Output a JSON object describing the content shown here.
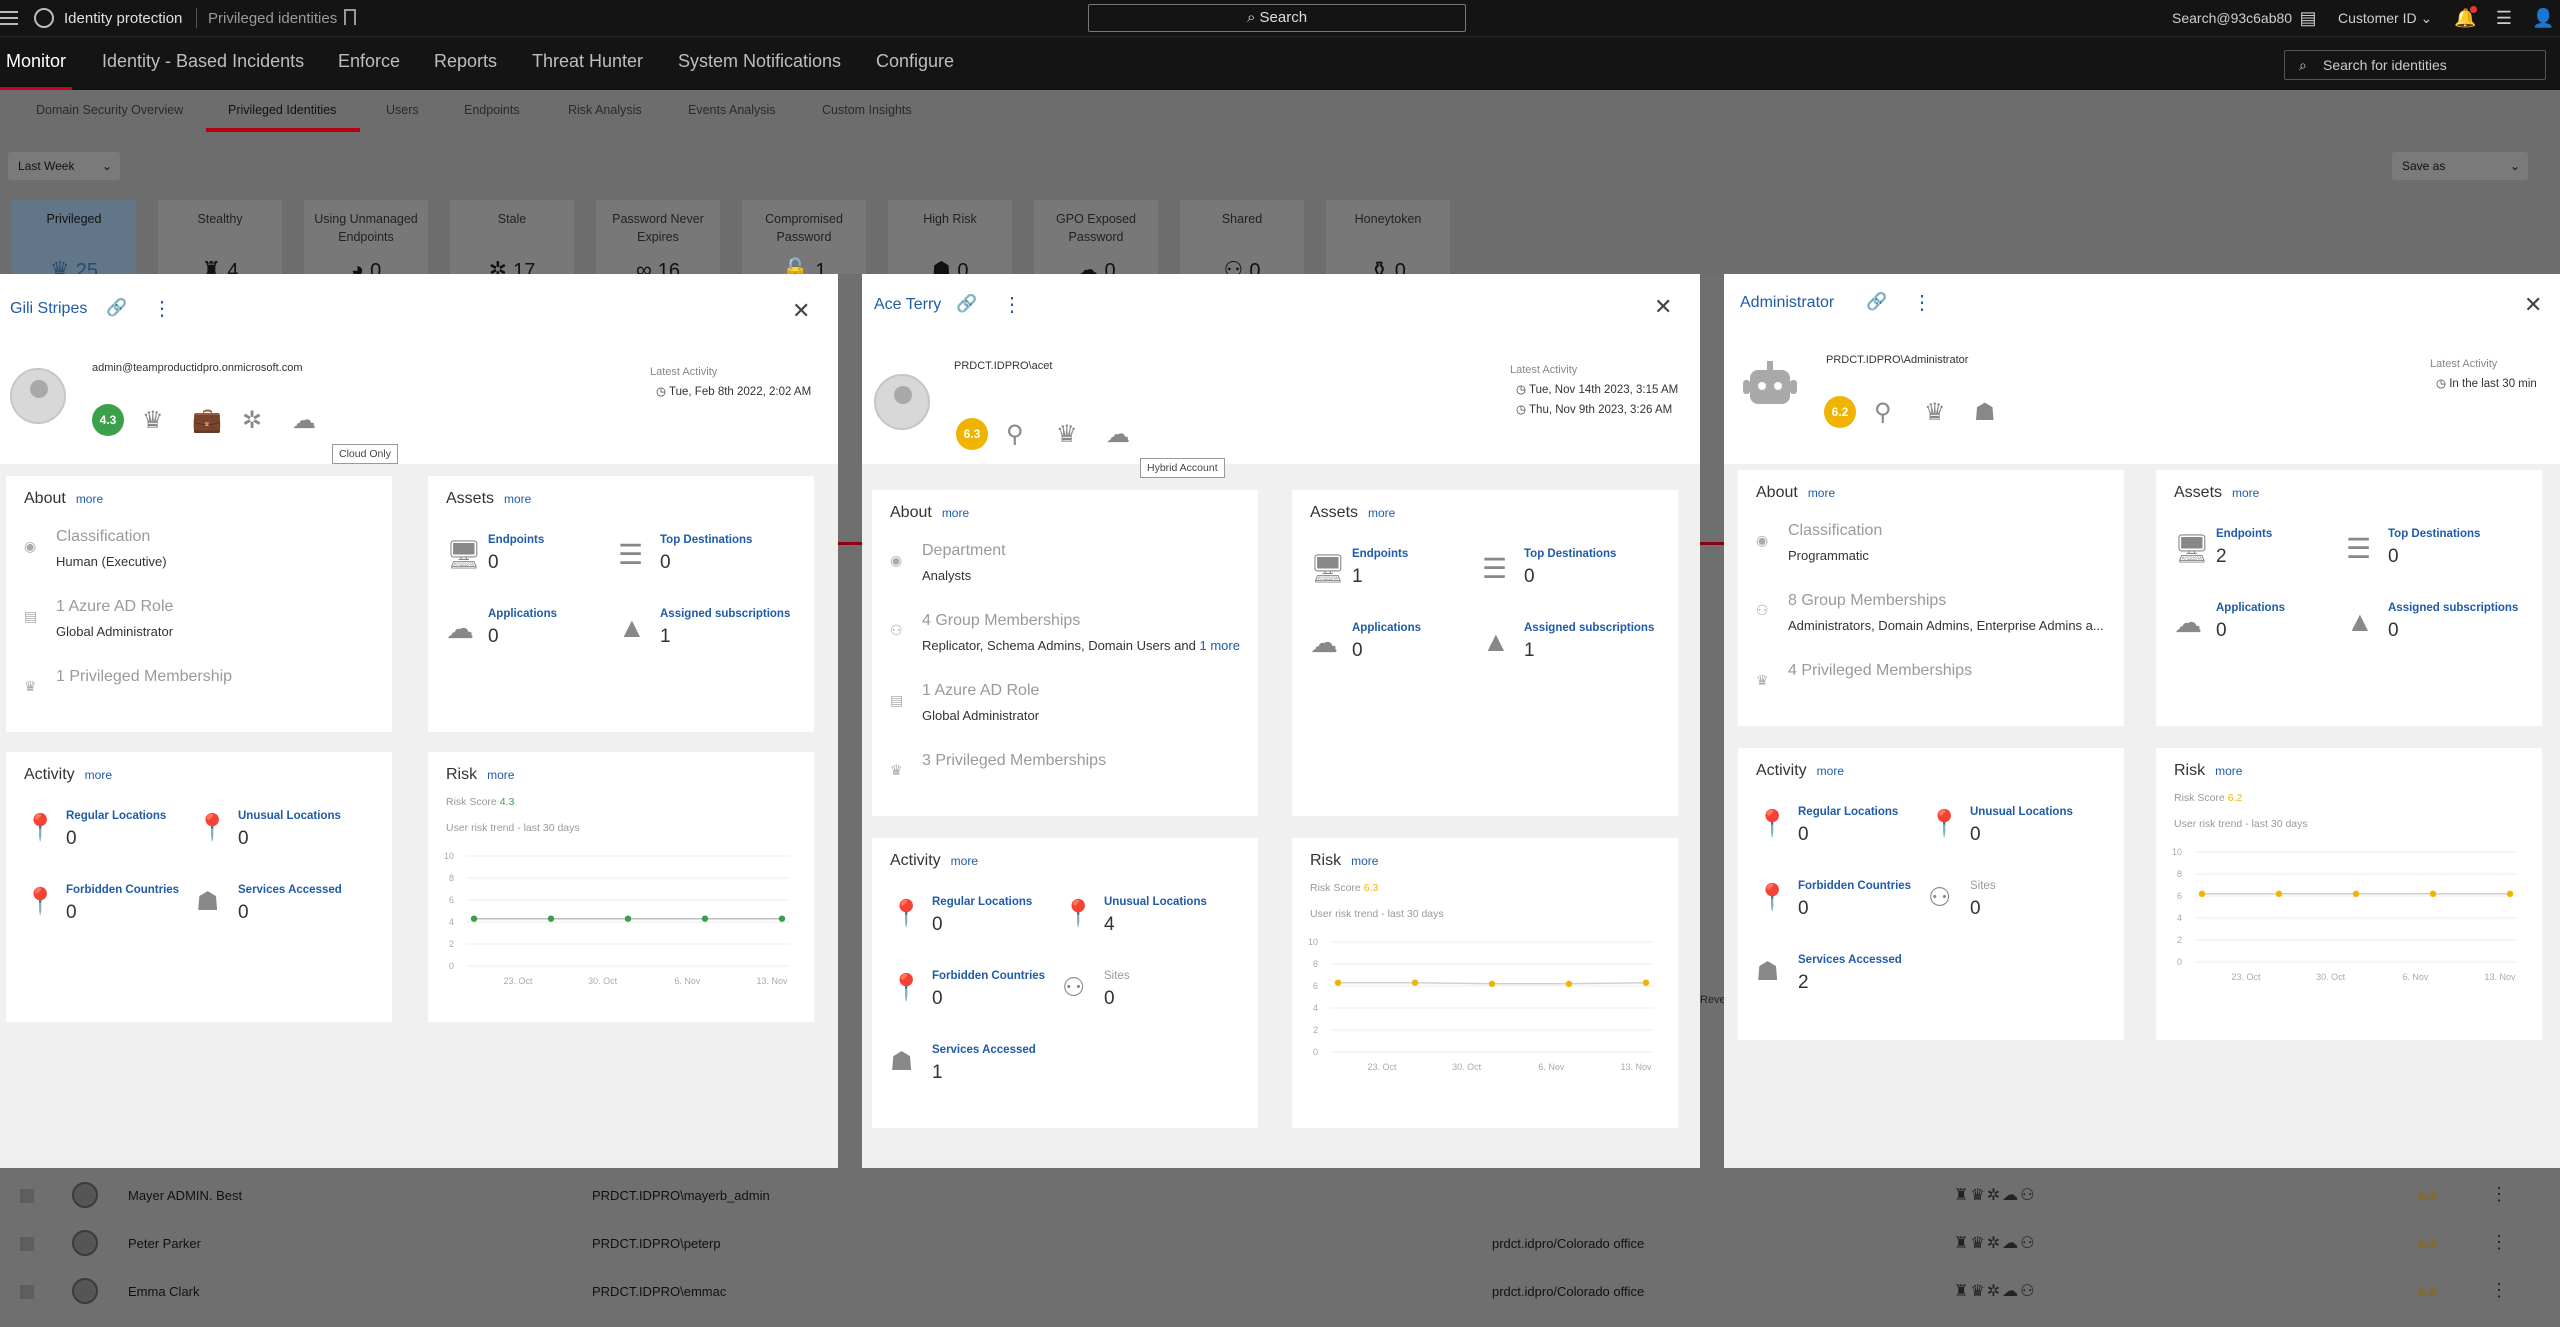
{
  "topbar": {
    "app_title": "Identity protection",
    "breadcrumb": "Privileged identities",
    "search_label": "Search",
    "user": "Search@93c6ab80",
    "customer": "Customer ID"
  },
  "main_nav": [
    "Monitor",
    "Identity - Based Incidents",
    "Enforce",
    "Reports",
    "Threat Hunter",
    "System Notifications",
    "Configure"
  ],
  "identity_search_placeholder": "Search for identities",
  "sub_nav": [
    "Domain Security Overview",
    "Privileged Identities",
    "Users",
    "Endpoints",
    "Risk Analysis",
    "Events Analysis",
    "Custom Insights"
  ],
  "filters": {
    "period": "Last Week",
    "save_as": "Save as"
  },
  "tiles": [
    {
      "label": "Privileged",
      "value": "25",
      "icon": "crown-icon",
      "glyph": "♛"
    },
    {
      "label": "Stealthy",
      "value": "4",
      "icon": "spy-icon",
      "glyph": "♜"
    },
    {
      "label": "Using Unmanaged Endpoints",
      "value": "0",
      "icon": "unmanaged-icon",
      "glyph": "◕"
    },
    {
      "label": "Stale",
      "value": "17",
      "icon": "stale-icon",
      "glyph": "✲"
    },
    {
      "label": "Password Never Expires",
      "value": "16",
      "icon": "infinity-icon",
      "glyph": "∞"
    },
    {
      "label": "Compromised Password",
      "value": "1",
      "icon": "unlock-icon",
      "glyph": "🔓"
    },
    {
      "label": "High Risk",
      "value": "0",
      "icon": "risk-user-icon",
      "glyph": "☗"
    },
    {
      "label": "GPO Exposed Password",
      "value": "0",
      "icon": "gpo-icon",
      "glyph": "☁"
    },
    {
      "label": "Shared",
      "value": "0",
      "icon": "shared-icon",
      "glyph": "⚇"
    },
    {
      "label": "Honeytoken",
      "value": "0",
      "icon": "honeytoken-icon",
      "glyph": "⚱"
    }
  ],
  "panels": [
    {
      "name": "Gili Stripes",
      "account": "admin@teamproductidpro.onmicrosoft.com",
      "latest_activity_label": "Latest Activity",
      "latest_activity": [
        "Tue, Feb 8th 2022, 2:02 AM"
      ],
      "score": "4.3",
      "score_color": "#3aa04a",
      "tooltip": "Cloud Only",
      "about": {
        "title": "About",
        "more": "more",
        "rows": [
          {
            "label": "Classification",
            "value": "Human (Executive)"
          },
          {
            "label": "1 Azure AD Role",
            "value": "Global Administrator"
          },
          {
            "label": "1 Privileged Membership",
            "value": ""
          }
        ]
      },
      "assets": {
        "title": "Assets",
        "more": "more",
        "items": [
          {
            "label": "Endpoints",
            "value": "0"
          },
          {
            "label": "Top Destinations",
            "value": "0"
          },
          {
            "label": "Applications",
            "value": "0"
          },
          {
            "label": "Assigned subscriptions",
            "value": "1"
          }
        ]
      },
      "activity": {
        "title": "Activity",
        "more": "more",
        "items": [
          {
            "label": "Regular Locations",
            "value": "0"
          },
          {
            "label": "Unusual Locations",
            "value": "0"
          },
          {
            "label": "Forbidden Countries",
            "value": "0"
          },
          {
            "label": "Services Accessed",
            "value": "0"
          }
        ]
      },
      "risk": {
        "title": "Risk",
        "more": "more",
        "score_text": "Risk Score",
        "score": "4.3",
        "trend": "User risk trend - last 30 days"
      }
    },
    {
      "name": "Ace Terry",
      "account": "PRDCT.IDPRO\\acet",
      "latest_activity_label": "Latest Activity",
      "latest_activity": [
        "Tue, Nov 14th 2023, 3:15 AM",
        "Thu, Nov 9th 2023, 3:26 AM"
      ],
      "score": "6.3",
      "score_color": "#f0b400",
      "tooltip": "Hybrid Account",
      "about": {
        "title": "About",
        "more": "more",
        "rows": [
          {
            "label": "Department",
            "value": "Analysts"
          },
          {
            "label": "4 Group Memberships",
            "value": "Replicator, Schema Admins, Domain Users and",
            "extra": "1 more"
          },
          {
            "label": "1 Azure AD Role",
            "value": "Global Administrator"
          },
          {
            "label": "3 Privileged Memberships",
            "value": ""
          }
        ]
      },
      "assets": {
        "title": "Assets",
        "more": "more",
        "items": [
          {
            "label": "Endpoints",
            "value": "1"
          },
          {
            "label": "Top Destinations",
            "value": "0"
          },
          {
            "label": "Applications",
            "value": "0"
          },
          {
            "label": "Assigned subscriptions",
            "value": "1"
          }
        ]
      },
      "activity": {
        "title": "Activity",
        "more": "more",
        "items": [
          {
            "label": "Regular Locations",
            "value": "0"
          },
          {
            "label": "Unusual Locations",
            "value": "4"
          },
          {
            "label": "Forbidden Countries",
            "value": "0"
          },
          {
            "label": "Sites",
            "value": "0"
          },
          {
            "label": "Services Accessed",
            "value": "1"
          }
        ]
      },
      "risk": {
        "title": "Risk",
        "more": "more",
        "score_text": "Risk Score",
        "score": "6.3",
        "trend": "User risk trend - last 30 days"
      }
    },
    {
      "name": "Administrator",
      "account": "PRDCT.IDPRO\\Administrator",
      "latest_activity_label": "Latest Activity",
      "latest_activity": [
        "In the last 30 min"
      ],
      "score": "6.2",
      "score_color": "#f0b400",
      "tooltip": "",
      "about": {
        "title": "About",
        "more": "more",
        "rows": [
          {
            "label": "Classification",
            "value": "Programmatic"
          },
          {
            "label": "8 Group Memberships",
            "value": "Administrators, Domain Admins, Enterprise Admins a..."
          },
          {
            "label": "4 Privileged Memberships",
            "value": ""
          }
        ]
      },
      "assets": {
        "title": "Assets",
        "more": "more",
        "items": [
          {
            "label": "Endpoints",
            "value": "2"
          },
          {
            "label": "Top Destinations",
            "value": "0"
          },
          {
            "label": "Applications",
            "value": "0"
          },
          {
            "label": "Assigned subscriptions",
            "value": "0"
          }
        ]
      },
      "activity": {
        "title": "Activity",
        "more": "more",
        "items": [
          {
            "label": "Regular Locations",
            "value": "0"
          },
          {
            "label": "Unusual Locations",
            "value": "0"
          },
          {
            "label": "Forbidden Countries",
            "value": "0"
          },
          {
            "label": "Sites",
            "value": "0"
          },
          {
            "label": "Services Accessed",
            "value": "2"
          }
        ]
      },
      "risk": {
        "title": "Risk",
        "more": "more",
        "score_text": "Risk Score",
        "score": "6.2",
        "trend": "User risk trend - last 30 days"
      }
    }
  ],
  "table_rows": [
    {
      "name": "Mayer ADMIN. Best",
      "account": "PRDCT.IDPRO\\mayerb_admin",
      "location": "",
      "score": "5.3"
    },
    {
      "name": "Peter Parker",
      "account": "PRDCT.IDPRO\\peterp",
      "location": "prdct.idpro/Colorado office",
      "score": "5.3"
    },
    {
      "name": "Emma Clark",
      "account": "PRDCT.IDPRO\\emmac",
      "location": "prdct.idpro/Colorado office",
      "score": "5.2"
    }
  ],
  "colors": {
    "accent": "#1f5ba8",
    "brand_red": "#d0021b",
    "score_green": "#3aa04a",
    "score_yellow": "#f0b400"
  },
  "chart_data": [
    {
      "type": "line",
      "x": [
        "23. Oct",
        "30. Oct",
        "6. Nov",
        "13. Nov"
      ],
      "ylim": [
        0,
        10
      ],
      "yticks": [
        0,
        2,
        4,
        6,
        8,
        10
      ],
      "series": [
        {
          "values": [
            4.3,
            4.3,
            4.3,
            4.3,
            4.3
          ],
          "color": "#3aa04a"
        }
      ]
    },
    {
      "type": "line",
      "x": [
        "23. Oct",
        "30. Oct",
        "6. Nov",
        "13. Nov"
      ],
      "ylim": [
        0,
        10
      ],
      "yticks": [
        0,
        2,
        4,
        6,
        8,
        10
      ],
      "series": [
        {
          "values": [
            6.3,
            6.3,
            6.2,
            6.2,
            6.3
          ],
          "color": "#f0b400"
        }
      ]
    },
    {
      "type": "line",
      "x": [
        "23. Oct",
        "30. Oct",
        "6. Nov",
        "13. Nov"
      ],
      "ylim": [
        0,
        10
      ],
      "yticks": [
        0,
        2,
        4,
        6,
        8,
        10
      ],
      "series": [
        {
          "values": [
            6.2,
            6.2,
            6.2,
            6.2,
            6.2
          ],
          "color": "#f0b400"
        }
      ]
    }
  ]
}
